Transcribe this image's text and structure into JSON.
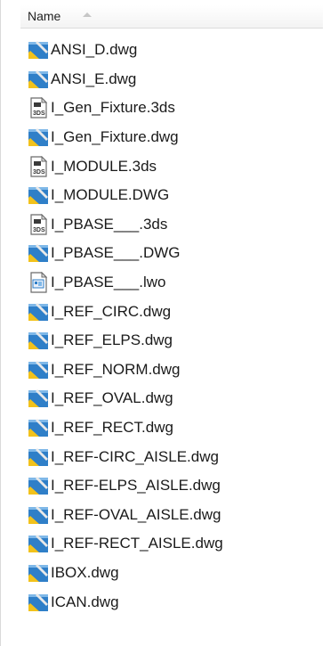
{
  "header": {
    "column_label": "Name",
    "sort_icon": "sort-ascending-icon"
  },
  "files": [
    {
      "name": "ANSI_D.dwg",
      "icon": "dwg-file-icon"
    },
    {
      "name": "ANSI_E.dwg",
      "icon": "dwg-file-icon"
    },
    {
      "name": "I_Gen_Fixture.3ds",
      "icon": "3ds-file-icon"
    },
    {
      "name": "I_Gen_Fixture.dwg",
      "icon": "dwg-file-icon"
    },
    {
      "name": "I_MODULE.3ds",
      "icon": "3ds-file-icon"
    },
    {
      "name": "I_MODULE.DWG",
      "icon": "dwg-file-icon"
    },
    {
      "name": "I_PBASE___.3ds",
      "icon": "3ds-file-icon"
    },
    {
      "name": "I_PBASE___.DWG",
      "icon": "dwg-file-icon"
    },
    {
      "name": "I_PBASE___.lwo",
      "icon": "lwo-file-icon"
    },
    {
      "name": "I_REF_CIRC.dwg",
      "icon": "dwg-file-icon"
    },
    {
      "name": "I_REF_ELPS.dwg",
      "icon": "dwg-file-icon"
    },
    {
      "name": "I_REF_NORM.dwg",
      "icon": "dwg-file-icon"
    },
    {
      "name": "I_REF_OVAL.dwg",
      "icon": "dwg-file-icon"
    },
    {
      "name": "I_REF_RECT.dwg",
      "icon": "dwg-file-icon"
    },
    {
      "name": "I_REF-CIRC_AISLE.dwg",
      "icon": "dwg-file-icon"
    },
    {
      "name": "I_REF-ELPS_AISLE.dwg",
      "icon": "dwg-file-icon"
    },
    {
      "name": "I_REF-OVAL_AISLE.dwg",
      "icon": "dwg-file-icon"
    },
    {
      "name": "I_REF-RECT_AISLE.dwg",
      "icon": "dwg-file-icon"
    },
    {
      "name": "IBOX.dwg",
      "icon": "dwg-file-icon"
    },
    {
      "name": "ICAN.dwg",
      "icon": "dwg-file-icon"
    }
  ],
  "colors": {
    "dwg_blue": "#2f7fc8",
    "dwg_yellow": "#f2c21b",
    "doc_border": "#6b6b6b"
  }
}
